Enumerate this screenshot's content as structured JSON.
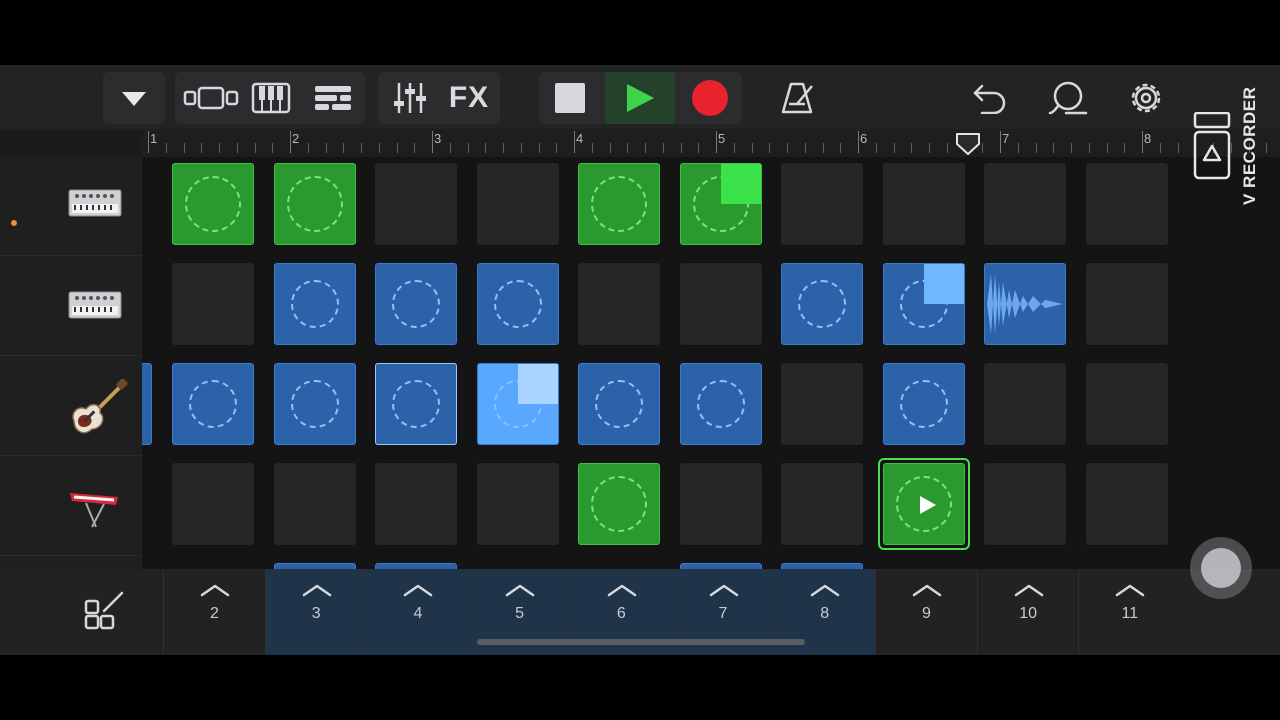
{
  "toolbar": {
    "fx_label": "FX",
    "buttons": [
      "tracks-dropdown-icon",
      "tracks-view-icon",
      "keyboard-icon",
      "live-loops-icon",
      "mixer-icon",
      "fx",
      "stop-icon",
      "play-icon",
      "record-icon",
      "metronome-icon",
      "undo-icon",
      "loop-browser-icon",
      "settings-icon"
    ],
    "colors": {
      "play": "#3dd44b",
      "record": "#e8232d"
    }
  },
  "ruler": {
    "bars": [
      "1",
      "2",
      "3",
      "4",
      "5",
      "6",
      "7",
      "8"
    ]
  },
  "tracks": [
    {
      "icon": "synth-module-icon",
      "armed": true
    },
    {
      "icon": "synth-module-icon",
      "armed": false
    },
    {
      "icon": "electric-guitar-icon",
      "armed": false
    },
    {
      "icon": "keyboard-synth-icon",
      "armed": false
    }
  ],
  "grid": {
    "rows": [
      [
        "green",
        "green",
        "empty",
        "empty",
        "green",
        "green-playing",
        "empty",
        "empty",
        "empty",
        "empty"
      ],
      [
        "empty",
        "blue",
        "blue",
        "blue",
        "empty",
        "empty",
        "blue",
        "blue-playing",
        "blue-wave",
        "empty"
      ],
      [
        "blue",
        "blue",
        "blue-selected",
        "blue-bright-playing",
        "blue",
        "blue",
        "empty",
        "blue",
        "empty",
        "empty"
      ],
      [
        "empty",
        "empty",
        "empty",
        "empty",
        "green",
        "empty",
        "empty",
        "green-queued",
        "empty",
        "empty"
      ]
    ]
  },
  "scenes": {
    "numbers": [
      "2",
      "3",
      "4",
      "5",
      "6",
      "7",
      "8",
      "9",
      "10",
      "11"
    ],
    "active": [
      "3",
      "4",
      "5",
      "6",
      "7",
      "8"
    ]
  },
  "overlay": {
    "recorder_label": "V RECORDER"
  }
}
